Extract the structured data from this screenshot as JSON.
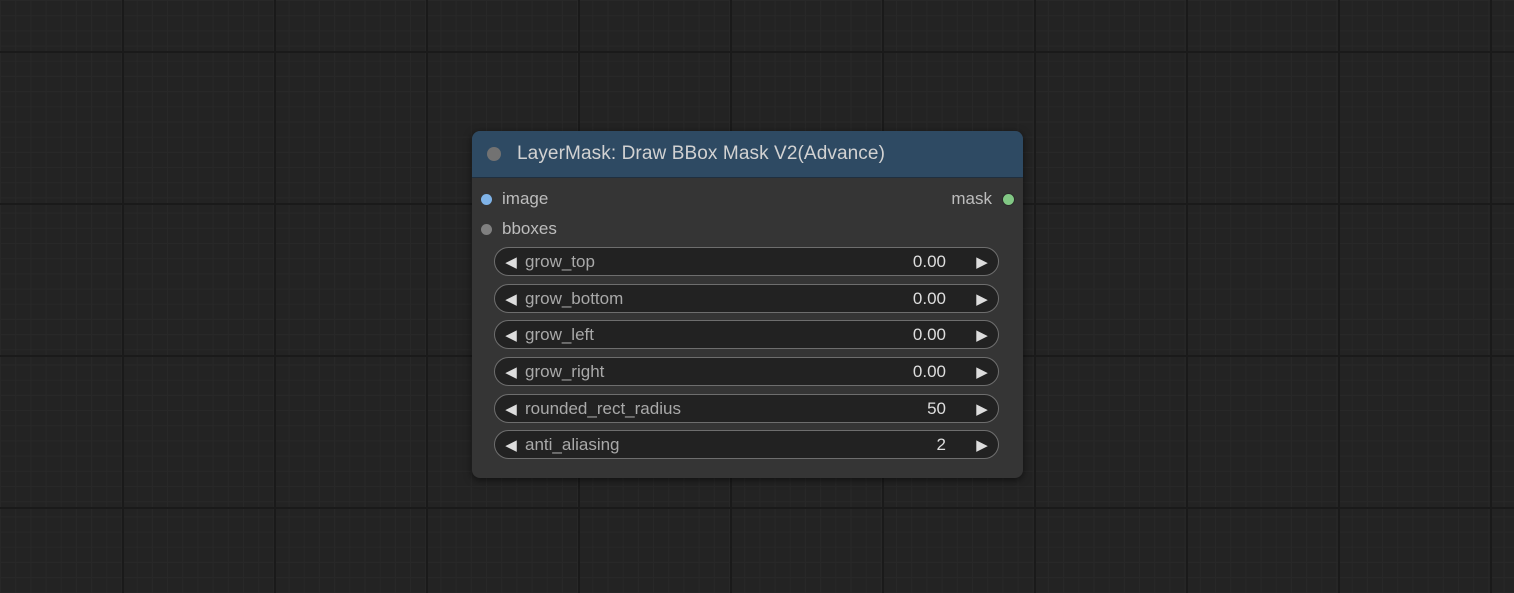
{
  "node": {
    "title": "LayerMask: Draw BBox Mask V2(Advance)",
    "header_color": "#2e4a63",
    "inputs": [
      {
        "name": "image",
        "color": "#7fb3e8"
      },
      {
        "name": "bboxes",
        "color": "#808080"
      }
    ],
    "outputs": [
      {
        "name": "mask",
        "color": "#81c784"
      }
    ],
    "widgets": [
      {
        "label": "grow_top",
        "value": "0.00"
      },
      {
        "label": "grow_bottom",
        "value": "0.00"
      },
      {
        "label": "grow_left",
        "value": "0.00"
      },
      {
        "label": "grow_right",
        "value": "0.00"
      },
      {
        "label": "rounded_rect_radius",
        "value": "50"
      },
      {
        "label": "anti_aliasing",
        "value": "2"
      }
    ]
  },
  "icons": {
    "decrement": "◀",
    "increment": "▶"
  }
}
